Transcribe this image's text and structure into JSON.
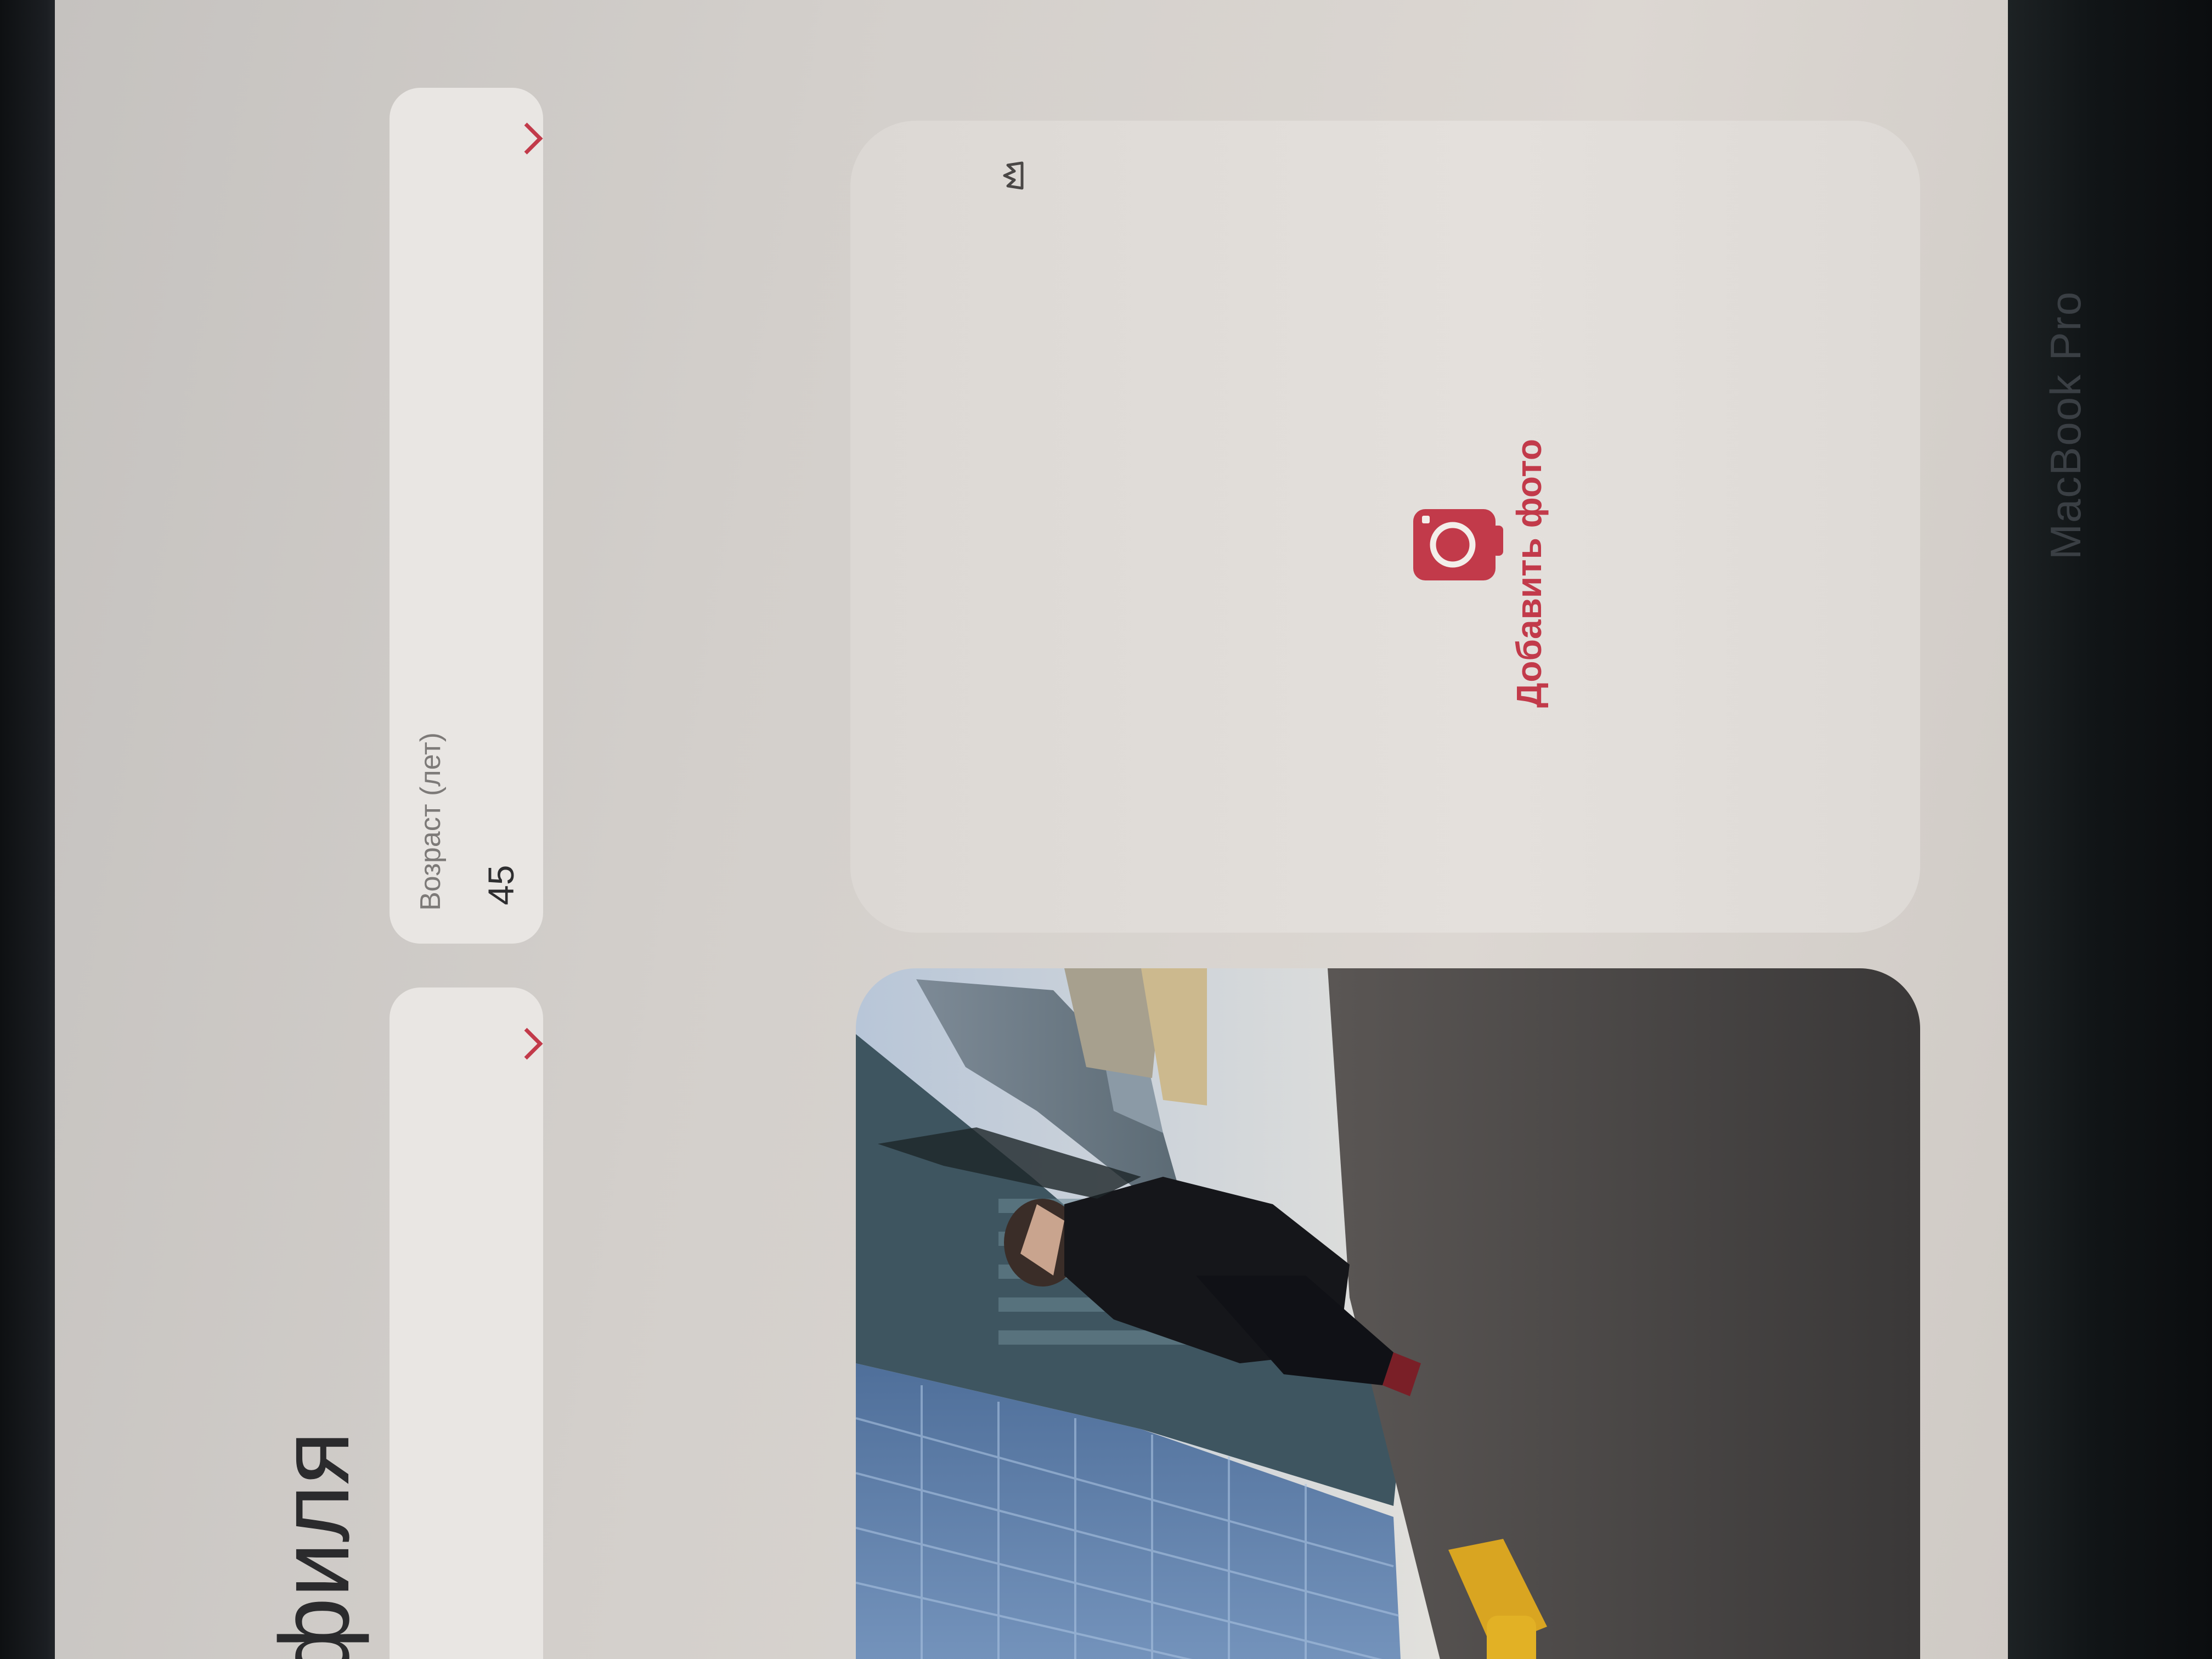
{
  "page": {
    "title_fragment": "филя",
    "left_label_fragment": "а"
  },
  "fields": {
    "age": {
      "label": "Возраст (лет)",
      "value": "45"
    }
  },
  "photo_upload": {
    "add_label": "Добавить фото"
  },
  "device": {
    "brand": "MacBook Pro"
  },
  "colors": {
    "accent": "#c23a4a"
  }
}
